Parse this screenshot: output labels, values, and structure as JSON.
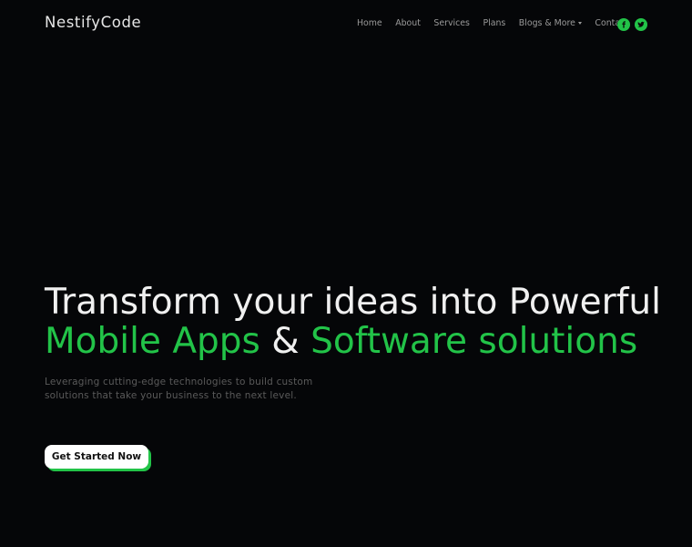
{
  "brand": {
    "name": "NestifyCode",
    "accent_color": "#22c348",
    "background_color": "#050608"
  },
  "nav": {
    "items": [
      {
        "label": "Home"
      },
      {
        "label": "About"
      },
      {
        "label": "Services"
      },
      {
        "label": "Plans"
      },
      {
        "label": "Blogs & More",
        "has_dropdown": true
      },
      {
        "label": "Contact"
      }
    ],
    "socials": [
      {
        "icon": "facebook-icon"
      },
      {
        "icon": "twitter-icon"
      }
    ]
  },
  "hero": {
    "line1": "Transform your ideas into Powerful",
    "line2_part1": "Mobile Apps",
    "line2_amp": "&",
    "line2_part2": "Software solutions",
    "subtitle": "Leveraging cutting-edge technologies to build custom solutions that take your business to the next level.",
    "cta_label": "Get Started Now"
  }
}
